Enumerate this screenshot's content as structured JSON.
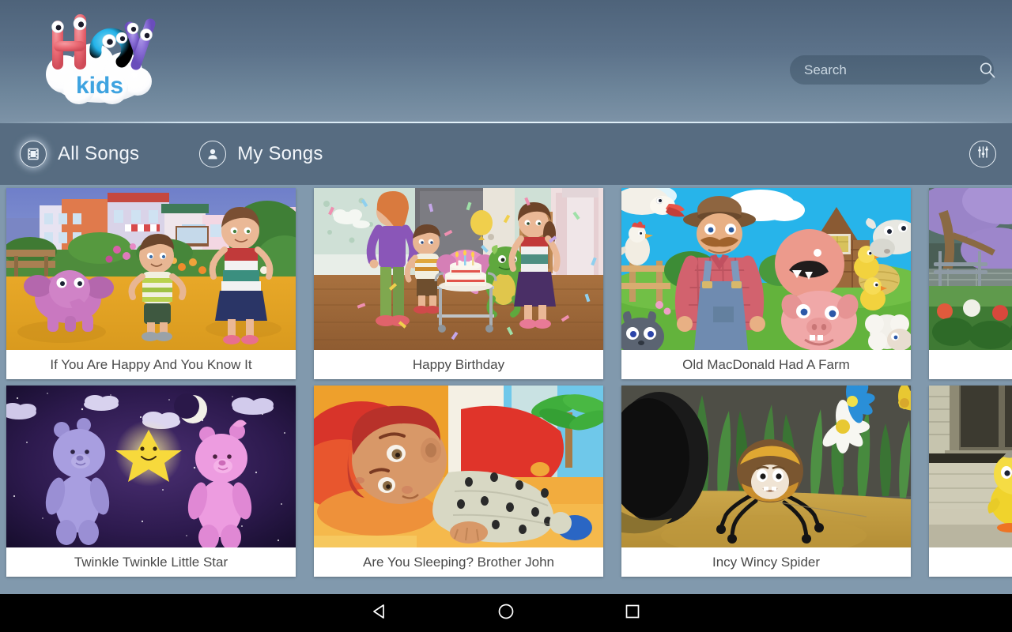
{
  "app": {
    "logo": {
      "name": "hey-kids-logo",
      "word_top": "Hey",
      "word_bottom": "kids",
      "colors": {
        "h": "#e8606b",
        "e": "#27b4e8",
        "y": "#8a6fd6",
        "cloud": "#ffffff",
        "kids_text": "#3ea3e0"
      }
    },
    "background_color": "#8199ad",
    "header_color": "#5b7189",
    "tabbar_color": "#576c81"
  },
  "search": {
    "placeholder": "Search",
    "value": "",
    "icon": "search-icon"
  },
  "tabs": [
    {
      "label": "All Songs",
      "icon": "film-strip-icon",
      "active": true
    },
    {
      "label": "My Songs",
      "icon": "person-icon",
      "active": false
    }
  ],
  "settings": {
    "icon": "equalizer-sliders-icon",
    "label": "Settings"
  },
  "grid": {
    "rows": [
      {
        "cards": [
          {
            "title": "If You Are Happy And You Know It",
            "thumb": "park-elephant-boy-girl"
          },
          {
            "title": "Happy Birthday",
            "thumb": "birthday-party-cake-confetti"
          },
          {
            "title": "Old MacDonald Had A Farm",
            "thumb": "farmer-pig-chicken-barn"
          },
          {
            "title": "",
            "thumb": "purple-tree-park-bench"
          }
        ]
      },
      {
        "cards": [
          {
            "title": "Twinkle Twinkle Little Star",
            "thumb": "night-sky-teddy-bears-star"
          },
          {
            "title": "Are You Sleeping? Brother John",
            "thumb": "boy-sleeping-panda-pajamas"
          },
          {
            "title": "Incy Wincy Spider",
            "thumb": "spider-grass-daisy"
          },
          {
            "title": "",
            "thumb": "yellow-ducklings-barn"
          }
        ]
      }
    ]
  },
  "navbar": {
    "buttons": [
      {
        "name": "back-button",
        "icon": "back-triangle-icon"
      },
      {
        "name": "home-button",
        "icon": "home-circle-icon"
      },
      {
        "name": "recents-button",
        "icon": "recents-square-icon"
      }
    ]
  }
}
